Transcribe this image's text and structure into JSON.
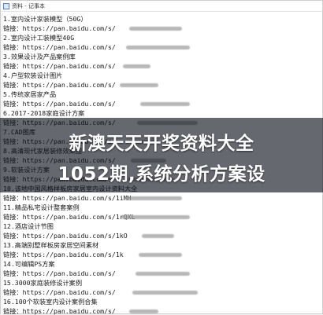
{
  "window": {
    "title": "资料 - 记事本"
  },
  "document": {
    "lines": [
      "1.室内设计家装模型（50G）",
      "链接：https://pan.baidu.com/s/",
      "2.室内设计工装模型40G",
      "链接：https://pan.baidu.com/s/",
      "3.效果设计及产品案例库",
      "链接：https://pan.baidu.com/s/",
      "4.户型软装设计图片",
      "链接：https://pan.baidu.com/s/",
      "5.传统家居家产品",
      "链接：https://pan.baidu.com/s/",
      "6.2017-2018家庭设计方案",
      "链接：https://pan.baidu.com/s/",
      "7.CAD图库",
      "链接：https://pan.baidu.com/s/",
      "8.高清现代家居装修效果图",
      "链接：https://pan.baidu.com/s/",
      "9.软装设计方案",
      "链接：https://pan.baidu.com/s/",
      "10.该地中国风格样板房家居室内设计资料大全",
      "链接：https://pan.baidu.com/s/1iMH",
      "11.精品私宅设计整套案例",
      "链接：https://pan.baidu.com/s/1rQXL",
      "12.酒店设计节图",
      "链接：https://pan.baidu.com/s/1kO",
      "13.高端别墅样板房家居空间素材",
      "链接：https://pan.baidu.com/s/1k",
      "14.可编辑PS方案",
      "链接：https://pan.baidu.com/s/",
      "15.3000家庭装修设计案例",
      "链接：https://pan.baidu.com/s/",
      "16.100个软装室内设计案例合集",
      "链接：https://pan.baidu.com/s/"
    ]
  },
  "overlay": {
    "headline_line1": "新澳天天开奖资料大全",
    "headline_line2": "1052期,系统分析方案设"
  },
  "colors": {
    "banner": "#0a0f1c",
    "headline": "#ffffff"
  }
}
